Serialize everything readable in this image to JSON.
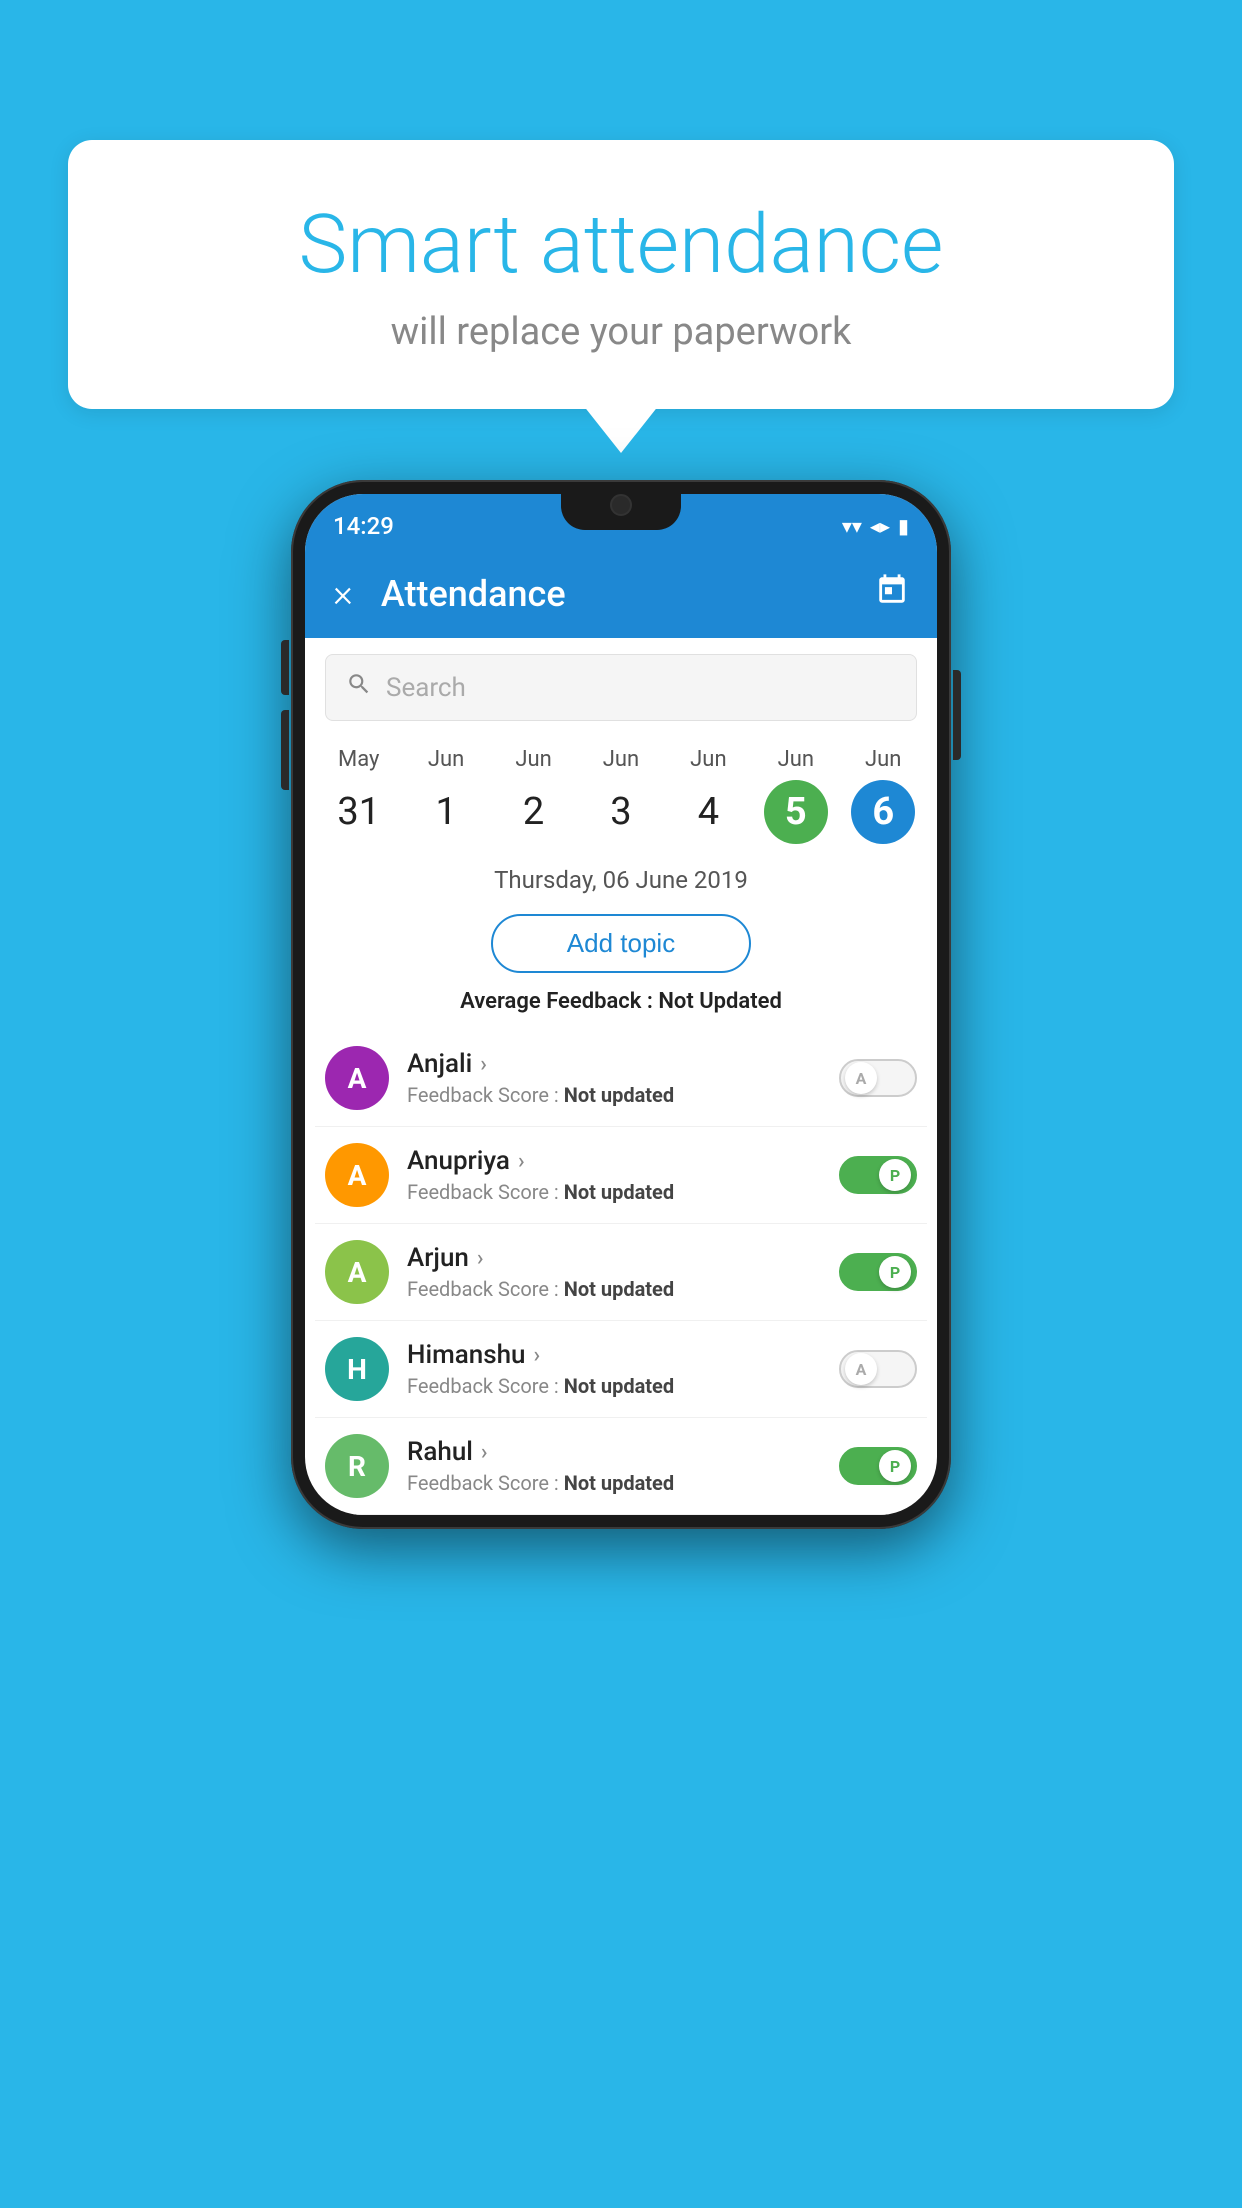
{
  "background_color": "#29b6e8",
  "speech_bubble": {
    "title": "Smart attendance",
    "subtitle": "will replace your paperwork"
  },
  "phone": {
    "status_bar": {
      "time": "14:29"
    },
    "app_bar": {
      "title": "Attendance",
      "close_label": "×",
      "calendar_icon": "📅"
    },
    "search": {
      "placeholder": "Search"
    },
    "calendar": {
      "days": [
        {
          "month": "May",
          "date": "31",
          "state": "normal"
        },
        {
          "month": "Jun",
          "date": "1",
          "state": "normal"
        },
        {
          "month": "Jun",
          "date": "2",
          "state": "normal"
        },
        {
          "month": "Jun",
          "date": "3",
          "state": "normal"
        },
        {
          "month": "Jun",
          "date": "4",
          "state": "normal"
        },
        {
          "month": "Jun",
          "date": "5",
          "state": "today"
        },
        {
          "month": "Jun",
          "date": "6",
          "state": "selected"
        }
      ]
    },
    "selected_date": "Thursday, 06 June 2019",
    "add_topic_label": "Add topic",
    "avg_feedback": {
      "label": "Average Feedback : ",
      "value": "Not Updated"
    },
    "students": [
      {
        "name": "Anjali",
        "initial": "A",
        "avatar_color": "purple",
        "feedback": "Not updated",
        "toggle_state": "off",
        "toggle_label": "A"
      },
      {
        "name": "Anupriya",
        "initial": "A",
        "avatar_color": "orange",
        "feedback": "Not updated",
        "toggle_state": "on",
        "toggle_label": "P"
      },
      {
        "name": "Arjun",
        "initial": "A",
        "avatar_color": "light-green",
        "feedback": "Not updated",
        "toggle_state": "on",
        "toggle_label": "P"
      },
      {
        "name": "Himanshu",
        "initial": "H",
        "avatar_color": "teal",
        "feedback": "Not updated",
        "toggle_state": "off",
        "toggle_label": "A"
      },
      {
        "name": "Rahul",
        "initial": "R",
        "avatar_color": "green",
        "feedback": "Not updated",
        "toggle_state": "on",
        "toggle_label": "P"
      }
    ]
  }
}
